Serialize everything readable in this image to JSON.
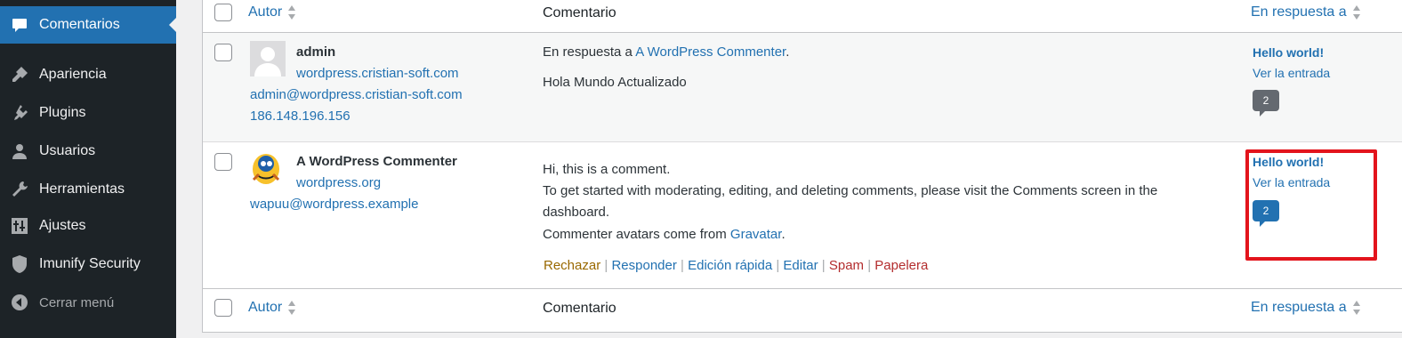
{
  "sidebar": {
    "items": [
      {
        "label": "Comentarios",
        "icon": "comment-icon",
        "active": true
      },
      {
        "label": "Apariencia",
        "icon": "paintbrush-icon"
      },
      {
        "label": "Plugins",
        "icon": "plugin-icon"
      },
      {
        "label": "Usuarios",
        "icon": "user-icon"
      },
      {
        "label": "Herramientas",
        "icon": "wrench-icon"
      },
      {
        "label": "Ajustes",
        "icon": "settings-icon"
      },
      {
        "label": "Imunify Security",
        "icon": "shield-icon"
      }
    ],
    "collapse": {
      "label": "Cerrar menú",
      "icon": "collapse-icon"
    }
  },
  "table": {
    "headers": {
      "author": "Autor",
      "comment": "Comentario",
      "response": "En respuesta a"
    },
    "rows": [
      {
        "author_name": "admin",
        "author_url": "wordpress.cristian-soft.com",
        "author_email": "admin@wordpress.cristian-soft.com",
        "author_ip": "186.148.196.156",
        "reply_prefix": "En respuesta a",
        "reply_to": "A WordPress Commenter",
        "reply_suffix": ".",
        "comment_text": "Hola Mundo Actualizado",
        "post_title": "Hello world!",
        "view_post": "Ver la entrada",
        "comment_count": "2"
      },
      {
        "author_name": "A WordPress Commenter",
        "author_url": "wordpress.org",
        "author_email": "wapuu@wordpress.example",
        "comment_lines": [
          "Hi, this is a comment.",
          "To get started with moderating, editing, and deleting comments, please visit the Comments screen in the",
          "dashboard."
        ],
        "avatar_line_prefix": "Commenter avatars come from",
        "avatar_link": "Gravatar",
        "avatar_line_suffix": ".",
        "actions": {
          "reject": "Rechazar",
          "reply": "Responder",
          "quick_edit": "Edición rápida",
          "edit": "Editar",
          "spam": "Spam",
          "trash": "Papelera",
          "separator": "|"
        },
        "post_title": "Hello world!",
        "view_post": "Ver la entrada",
        "comment_count": "2"
      }
    ]
  },
  "colors": {
    "sidebar_bg": "#1d2327",
    "active_bg": "#2271b1",
    "link": "#2271b1",
    "reject": "#996800",
    "delete": "#b32d2e",
    "highlight": "#e3141c"
  }
}
